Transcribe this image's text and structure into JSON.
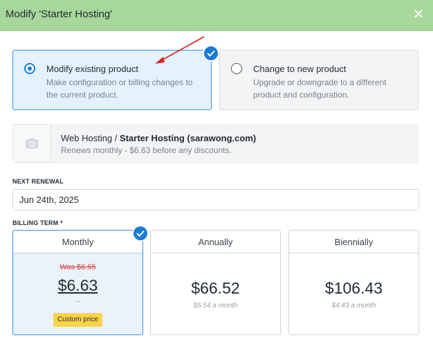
{
  "dialog": {
    "title": "Modify 'Starter Hosting'",
    "close_icon": "close-icon",
    "header_color": "#a7d79a"
  },
  "options": [
    {
      "title": "Modify existing product",
      "description": "Make configuration or billing changes to the current product.",
      "selected": true
    },
    {
      "title": "Change to new product",
      "description": "Upgrade or downgrade to a different product and configuration.",
      "selected": false
    }
  ],
  "product": {
    "category": "Web Hosting",
    "separator": " / ",
    "name": "Starter Hosting (sarawong.com)",
    "renewal_text": "Renews monthly - $6.63 before any discounts.",
    "thumbnail_icon": "camera-icon"
  },
  "next_renewal": {
    "label": "NEXT RENEWAL",
    "value": "Jun 24th, 2025"
  },
  "billing_term": {
    "label": "BILLING TERM *",
    "terms": [
      {
        "name": "Monthly",
        "was": "Was $6.65",
        "price": "$6.63",
        "dash": "–",
        "badge": "Custom price",
        "selected": true
      },
      {
        "name": "Annually",
        "price": "$66.52",
        "per_month": "$5.54 a month",
        "selected": false
      },
      {
        "name": "Biennially",
        "price": "$106.43",
        "per_month": "$4.43 a month",
        "selected": false
      }
    ]
  },
  "colors": {
    "accent": "#1a7bd6",
    "selected_bg": "#e3f2fd",
    "strike_red": "#e0413e",
    "badge_yellow": "#f8d44c",
    "annotation_arrow": "#e02020"
  }
}
